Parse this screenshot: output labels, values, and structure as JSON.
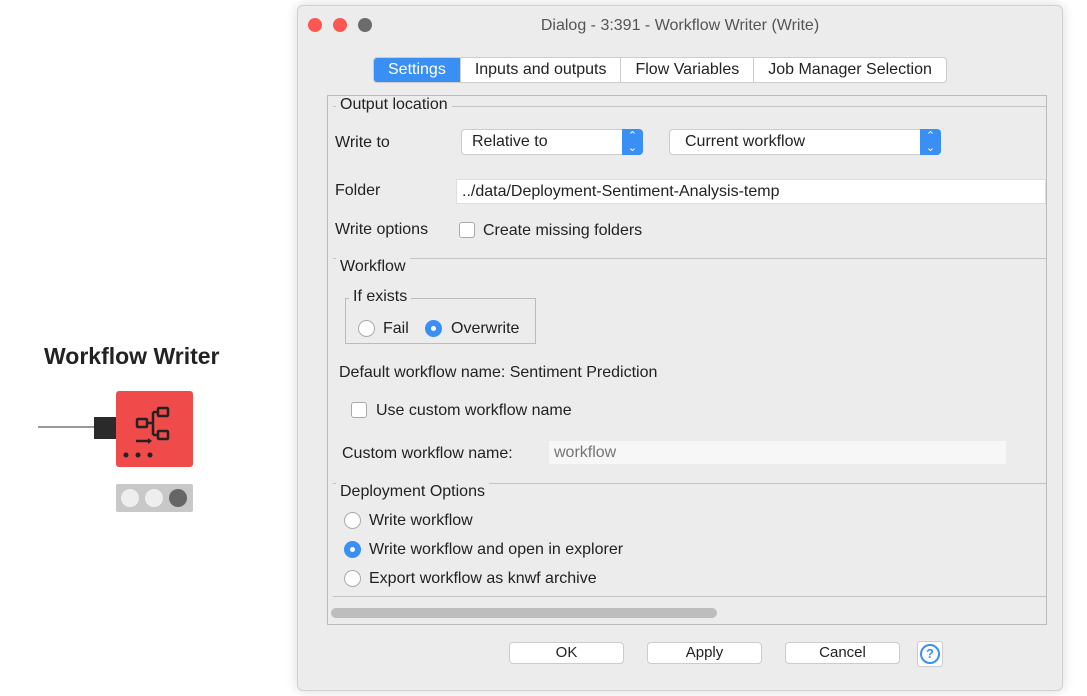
{
  "node": {
    "title": "Workflow Writer",
    "color": "#f04b4b",
    "icon": "workflow-tree-icon",
    "status": [
      "inactive",
      "inactive",
      "inactive-dark"
    ]
  },
  "dialog": {
    "title": "Dialog - 3:391 - Workflow Writer (Write)",
    "tabs": [
      {
        "label": "Settings",
        "active": true
      },
      {
        "label": "Inputs and outputs"
      },
      {
        "label": "Flow Variables"
      },
      {
        "label": "Job Manager Selection"
      }
    ],
    "output_location": {
      "header": "Output location",
      "write_to_label": "Write to",
      "write_to_mode": "Relative to",
      "write_to_target": "Current workflow",
      "folder_label": "Folder",
      "folder_value": "../data/Deployment-Sentiment-Analysis-temp",
      "write_options_label": "Write options",
      "create_missing_folders": "Create missing folders",
      "create_missing_checked": false
    },
    "workflow": {
      "header": "Workflow",
      "if_exists_header": "If exists",
      "fail": "Fail",
      "overwrite": "Overwrite",
      "selected": "Overwrite",
      "default_name": "Default workflow name: Sentiment Prediction",
      "use_custom": "Use custom workflow name",
      "use_custom_checked": false,
      "custom_label": "Custom workflow name:",
      "custom_placeholder": "workflow"
    },
    "deployment": {
      "header": "Deployment Options",
      "options": [
        "Write workflow",
        "Write workflow and open in explorer",
        "Export workflow as knwf archive"
      ],
      "selected": "Write workflow and open in explorer"
    },
    "buttons": {
      "ok": "OK",
      "apply": "Apply",
      "cancel": "Cancel",
      "help": "?"
    },
    "accent": "#3a8ff5"
  }
}
